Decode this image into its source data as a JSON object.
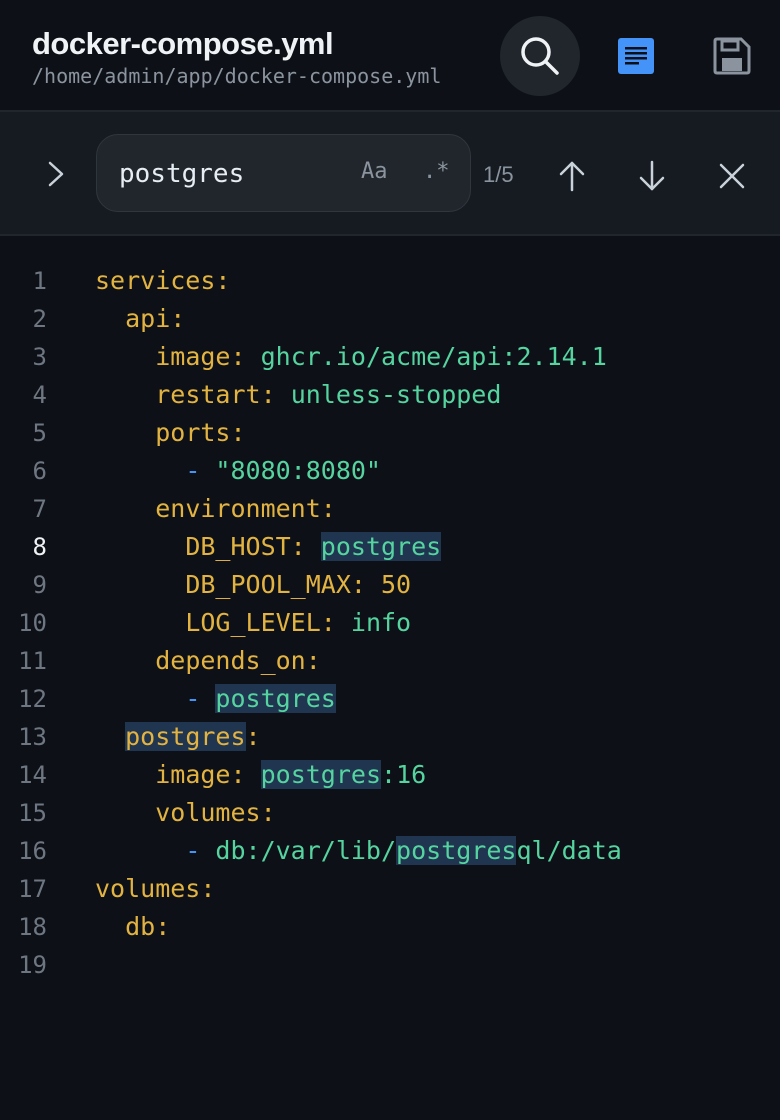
{
  "header": {
    "title": "docker-compose.yml",
    "path": "/home/admin/app/docker-compose.yml"
  },
  "icons": {
    "search": "search-icon",
    "document": "document-icon",
    "save": "save-icon",
    "expand": "chevron-right-icon",
    "prev": "arrow-up-icon",
    "next": "arrow-down-icon",
    "close": "close-icon"
  },
  "colors": {
    "accent": "#4493f8",
    "key": "#e3b341",
    "string": "#56d4a0",
    "highlight": "#1f3550"
  },
  "find": {
    "query": "postgres",
    "case_label": "Aa",
    "regex_label": ".*",
    "match_count": "1/5"
  },
  "editor": {
    "active_line": 8,
    "lines": [
      {
        "num": "1"
      },
      {
        "num": "2"
      },
      {
        "num": "3"
      },
      {
        "num": "4"
      },
      {
        "num": "5"
      },
      {
        "num": "6"
      },
      {
        "num": "7"
      },
      {
        "num": "8"
      },
      {
        "num": "9"
      },
      {
        "num": "10"
      },
      {
        "num": "11"
      },
      {
        "num": "12"
      },
      {
        "num": "13"
      },
      {
        "num": "14"
      },
      {
        "num": "15"
      },
      {
        "num": "16"
      },
      {
        "num": "17"
      },
      {
        "num": "18"
      },
      {
        "num": "19"
      }
    ],
    "tokens": {
      "l1_key": "services",
      "l1_colon": ":",
      "l2_key": "api",
      "l2_colon": ":",
      "l3_key": "image",
      "l3_colon": ": ",
      "l3_val": "ghcr.io/acme/api:2.14.1",
      "l4_key": "restart",
      "l4_colon": ": ",
      "l4_val": "unless-stopped",
      "l5_key": "ports",
      "l5_colon": ":",
      "l6_dash": "- ",
      "l6_val": "\"8080:8080\"",
      "l7_key": "environment",
      "l7_colon": ":",
      "l8_key": "DB_HOST",
      "l8_colon": ": ",
      "l8_val": "postgres",
      "l9_key": "DB_POOL_MAX",
      "l9_colon": ": ",
      "l9_val": "50",
      "l10_key": "LOG_LEVEL",
      "l10_colon": ": ",
      "l10_val": "info",
      "l11_key": "depends_on",
      "l11_colon": ":",
      "l12_dash": "- ",
      "l12_val": "postgres",
      "l13_key": "postgres",
      "l13_colon": ":",
      "l14_key": "image",
      "l14_colon": ": ",
      "l14_val_hl": "postgres",
      "l14_val_rest": ":16",
      "l15_key": "volumes",
      "l15_colon": ":",
      "l16_dash": "- ",
      "l16_val_pre": "db:/var/lib/",
      "l16_val_hl": "postgres",
      "l16_val_post": "ql/data",
      "l17_key": "volumes",
      "l17_colon": ":",
      "l18_key": "db",
      "l18_colon": ":"
    }
  }
}
